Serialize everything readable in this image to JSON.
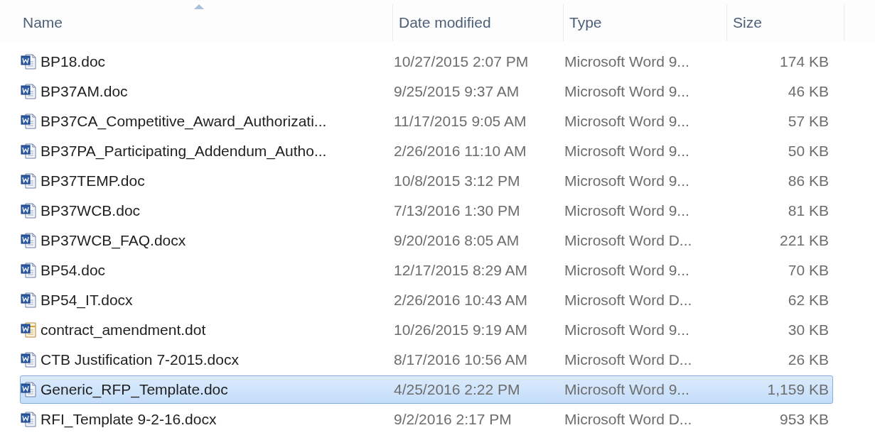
{
  "columns": [
    {
      "label": "Name",
      "sorted": true
    },
    {
      "label": "Date modified",
      "sorted": false
    },
    {
      "label": "Type",
      "sorted": false
    },
    {
      "label": "Size",
      "sorted": false
    }
  ],
  "files": [
    {
      "name": "BP18.doc",
      "date": "10/27/2015 2:07 PM",
      "type": "Microsoft Word 9...",
      "size": "174 KB",
      "kind": "document",
      "selected": false
    },
    {
      "name": "BP37AM.doc",
      "date": "9/25/2015 9:37 AM",
      "type": "Microsoft Word 9...",
      "size": "46 KB",
      "kind": "document",
      "selected": false
    },
    {
      "name": "BP37CA_Competitive_Award_Authorizati...",
      "date": "11/17/2015 9:05 AM",
      "type": "Microsoft Word 9...",
      "size": "57 KB",
      "kind": "document",
      "selected": false
    },
    {
      "name": "BP37PA_Participating_Addendum_Autho...",
      "date": "2/26/2016 11:10 AM",
      "type": "Microsoft Word 9...",
      "size": "50 KB",
      "kind": "document",
      "selected": false
    },
    {
      "name": "BP37TEMP.doc",
      "date": "10/8/2015 3:12 PM",
      "type": "Microsoft Word 9...",
      "size": "86 KB",
      "kind": "document",
      "selected": false
    },
    {
      "name": "BP37WCB.doc",
      "date": "7/13/2016 1:30 PM",
      "type": "Microsoft Word 9...",
      "size": "81 KB",
      "kind": "document",
      "selected": false
    },
    {
      "name": "BP37WCB_FAQ.docx",
      "date": "9/20/2016 8:05 AM",
      "type": "Microsoft Word D...",
      "size": "221 KB",
      "kind": "document",
      "selected": false
    },
    {
      "name": "BP54.doc",
      "date": "12/17/2015 8:29 AM",
      "type": "Microsoft Word 9...",
      "size": "70 KB",
      "kind": "document",
      "selected": false
    },
    {
      "name": "BP54_IT.docx",
      "date": "2/26/2016 10:43 AM",
      "type": "Microsoft Word D...",
      "size": "62 KB",
      "kind": "document",
      "selected": false
    },
    {
      "name": "contract_amendment.dot",
      "date": "10/26/2015 9:19 AM",
      "type": "Microsoft Word 9...",
      "size": "30 KB",
      "kind": "template",
      "selected": false
    },
    {
      "name": "CTB Justification 7-2015.docx",
      "date": "8/17/2016 10:56 AM",
      "type": "Microsoft Word D...",
      "size": "26 KB",
      "kind": "document",
      "selected": false
    },
    {
      "name": "Generic_RFP_Template.doc",
      "date": "4/25/2016 2:22 PM",
      "type": "Microsoft Word 9...",
      "size": "1,159 KB",
      "kind": "document",
      "selected": true
    },
    {
      "name": "RFI_Template 9-2-16.docx",
      "date": "9/2/2016 2:17 PM",
      "type": "Microsoft Word D...",
      "size": "953 KB",
      "kind": "document",
      "selected": false
    }
  ]
}
